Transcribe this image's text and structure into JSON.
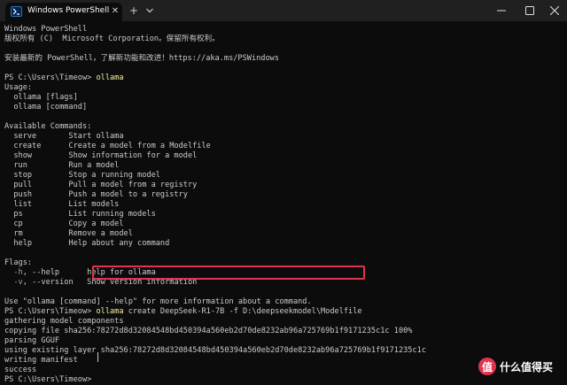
{
  "window": {
    "tab_title": "Windows PowerShell",
    "tab_icon": "powershell-icon",
    "close_tab_glyph": "✕",
    "new_tab_glyph": "+",
    "controls": [
      "minimize-icon",
      "maximize-icon",
      "close-icon"
    ]
  },
  "colors": {
    "background": "#0c0c0c",
    "titlebar": "#202020",
    "text": "#cccccc",
    "command": "#f9f1a5",
    "highlight_box": "#e0334f"
  },
  "terminal": {
    "lines": [
      {
        "text": "Windows PowerShell"
      },
      {
        "text": "版权所有 (C)  Microsoft Corporation。保留所有权利。"
      },
      {
        "text": ""
      },
      {
        "text": "安装最新的 PowerShell，了解新功能和改进！https://aka.ms/PSWindows"
      },
      {
        "text": ""
      },
      {
        "prompt": "PS C:\\Users\\Timeow> ",
        "command": "ollama"
      },
      {
        "text": "Usage:"
      },
      {
        "text": "  ollama [flags]"
      },
      {
        "text": "  ollama [command]"
      },
      {
        "text": ""
      },
      {
        "text": "Available Commands:"
      },
      {
        "text": "  serve       Start ollama"
      },
      {
        "text": "  create      Create a model from a Modelfile"
      },
      {
        "text": "  show        Show information for a model"
      },
      {
        "text": "  run         Run a model"
      },
      {
        "text": "  stop        Stop a running model"
      },
      {
        "text": "  pull        Pull a model from a registry"
      },
      {
        "text": "  push        Push a model to a registry"
      },
      {
        "text": "  list        List models"
      },
      {
        "text": "  ps          List running models"
      },
      {
        "text": "  cp          Copy a model"
      },
      {
        "text": "  rm          Remove a model"
      },
      {
        "text": "  help        Help about any command"
      },
      {
        "text": ""
      },
      {
        "text": "Flags:"
      },
      {
        "prefix": "  ",
        "flag": "-h",
        "text": ", --help      help for ollama"
      },
      {
        "prefix": "  ",
        "flag": "-v",
        "text": ", --version   Show version information"
      },
      {
        "text": ""
      },
      {
        "text": "Use \"ollama [command] --help\" for more information about a command."
      },
      {
        "prompt": "PS C:\\Users\\Timeow> ",
        "command": "ollama",
        "command_rest": " create DeepSeek-R1-7B -f D:\\deepseekmodel\\Modelfile",
        "highlighted": true
      },
      {
        "text": "gathering model components"
      },
      {
        "text": "copying file sha256:78272d8d32084548bd450394a560eb2d70de8232ab96a725769b1f9171235c1c 100%"
      },
      {
        "text": "parsing GGUF"
      },
      {
        "text": "using existing layer sha256:78272d8d32084548bd450394a560eb2d70de8232ab96a725769b1f9171235c1c"
      },
      {
        "text": "writing manifest"
      },
      {
        "text": "success"
      },
      {
        "prompt": "PS C:\\Users\\Timeow> ",
        "cursor": true
      }
    ]
  },
  "watermark": {
    "logo": "值",
    "text": "什么值得买"
  }
}
